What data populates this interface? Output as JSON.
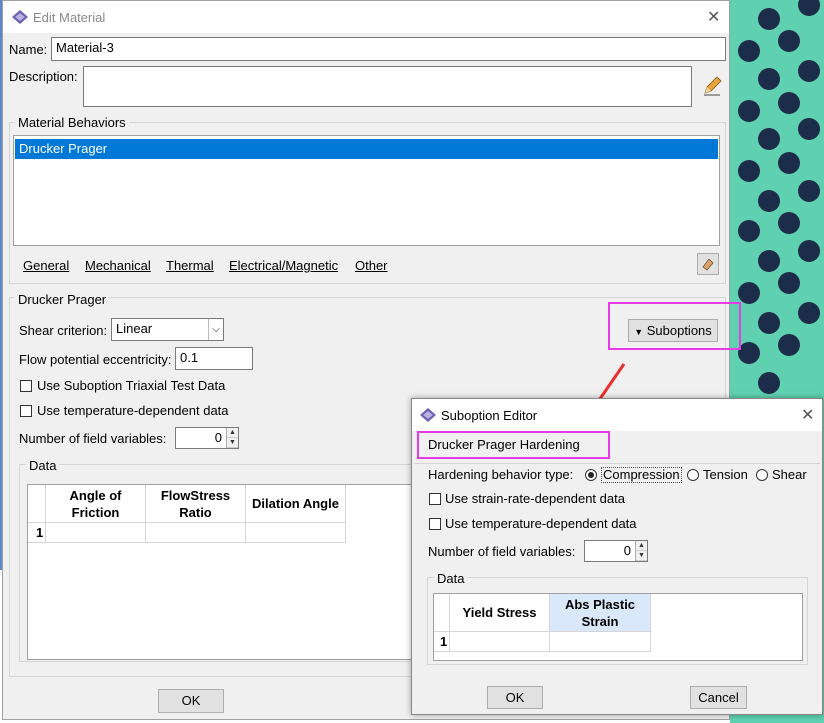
{
  "main_dialog": {
    "title": "Edit Material",
    "name_label": "Name:",
    "name_value": "Material-3",
    "description_label": "Description:",
    "description_value": "",
    "behaviors_group_title": "Material Behaviors",
    "behaviors": [
      "Drucker Prager"
    ],
    "menu_tabs": [
      "General",
      "Mechanical",
      "Thermal",
      "Electrical/Magnetic",
      "Other"
    ],
    "section_title": "Drucker Prager",
    "shear_label": "Shear criterion:",
    "shear_value": "Linear",
    "suboptions_button": "Suboptions",
    "flow_label": "Flow potential eccentricity:",
    "flow_value": "0.1",
    "triaxial_label": "Use Suboption Triaxial Test Data",
    "temperature_label": "Use temperature-dependent data",
    "field_vars_label": "Number of field variables:",
    "field_vars_value": "0",
    "data_group_title": "Data",
    "table_headers": [
      "Angle of Friction",
      "FlowStress Ratio",
      "Dilation Angle"
    ],
    "row_numbers": [
      "1"
    ],
    "ok_button": "OK"
  },
  "sub_dialog": {
    "title": "Suboption Editor",
    "heading": "Drucker Prager Hardening",
    "hardening_label": "Hardening behavior type:",
    "hardening_options": [
      "Compression",
      "Tension",
      "Shear"
    ],
    "hardening_selected": "Compression",
    "strain_rate_label": "Use strain-rate-dependent data",
    "temperature_label": "Use temperature-dependent data",
    "field_vars_label": "Number of field variables:",
    "field_vars_value": "0",
    "data_group_title": "Data",
    "table_headers": [
      "Yield Stress",
      "Abs Plastic Strain"
    ],
    "row_numbers": [
      "1"
    ],
    "ok_button": "OK",
    "cancel_button": "Cancel"
  },
  "colors": {
    "selection": "#0078d7",
    "highlight": "#e63be6",
    "arrow": "#e8302c",
    "background_green": "#5fd1b0"
  }
}
